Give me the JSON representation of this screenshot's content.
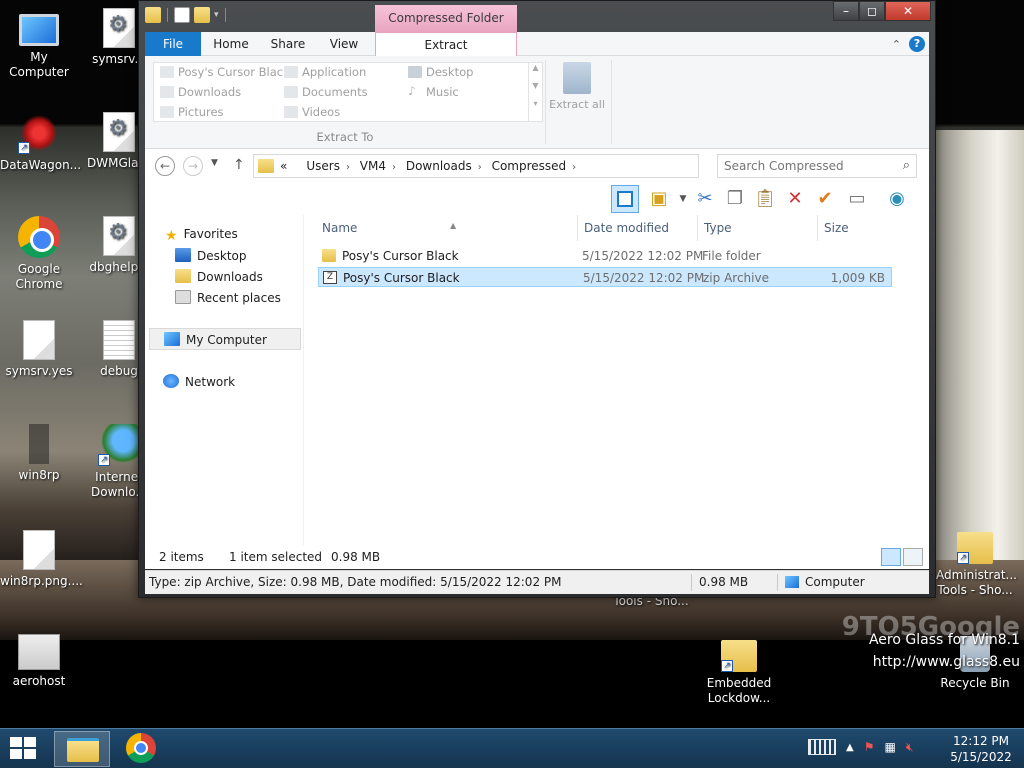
{
  "desktop": {
    "icons": [
      {
        "label": "My Computer"
      },
      {
        "label": "symsrv.d"
      },
      {
        "label": "DataWagon..."
      },
      {
        "label": "DWMGlass"
      },
      {
        "label": "Google Chrome"
      },
      {
        "label": "dbghelp.c"
      },
      {
        "label": "symsrv.yes"
      },
      {
        "label": "debug"
      },
      {
        "label": "win8rp"
      },
      {
        "label": "Internet Downlo..."
      },
      {
        "label": "win8rp.png...."
      },
      {
        "label": "aerohost"
      },
      {
        "label": "Embedded Lockdow..."
      },
      {
        "label": "Administrat... Tools - Sho..."
      },
      {
        "label": "Recycle Bin"
      }
    ],
    "hidden_label": "Tools - Sho...",
    "watermark": "9TO5Google",
    "aero_line1": "Aero Glass for Win8.1",
    "aero_line2": "http://www.glass8.eu"
  },
  "window": {
    "contextual_tab": "Compressed Folder Tools",
    "tabs": {
      "file": "File",
      "home": "Home",
      "share": "Share",
      "view": "View",
      "extract": "Extract"
    },
    "extract_to": {
      "items": [
        "Posy's Cursor Black",
        "Downloads",
        "Pictures",
        "Application",
        "Documents",
        "Videos",
        "Desktop",
        "Music"
      ],
      "group_label": "Extract To"
    },
    "extract_all": "Extract all",
    "address": {
      "crumbs": [
        "Users",
        "VM4",
        "Downloads",
        "Compressed"
      ],
      "overflow": "«"
    },
    "search": {
      "placeholder": "Search Compressed"
    },
    "nav": {
      "favorites": "Favorites",
      "desktop": "Desktop",
      "downloads": "Downloads",
      "recent": "Recent places",
      "computer": "My Computer",
      "network": "Network"
    },
    "columns": {
      "name": "Name",
      "date": "Date modified",
      "type": "Type",
      "size": "Size"
    },
    "files": [
      {
        "name": "Posy's Cursor Black",
        "date": "5/15/2022 12:02 PM",
        "type": "File folder",
        "size": ""
      },
      {
        "name": "Posy's Cursor Black",
        "date": "5/15/2022 12:02 PM",
        "type": "zip Archive",
        "size": "1,009 KB"
      }
    ],
    "status": {
      "items": "2 items",
      "selected": "1 item selected",
      "selected_size": "0.98 MB",
      "details": "Type: zip Archive, Size: 0.98 MB, Date modified: 5/15/2022 12:02 PM",
      "size": "0.98 MB",
      "location": "Computer"
    }
  },
  "taskbar": {
    "time": "12:12 PM",
    "date": "5/15/2022"
  },
  "colors": {
    "file_tab": "#1979ca",
    "contextual": "#e9a5c0",
    "selection": "#cce8ff"
  }
}
